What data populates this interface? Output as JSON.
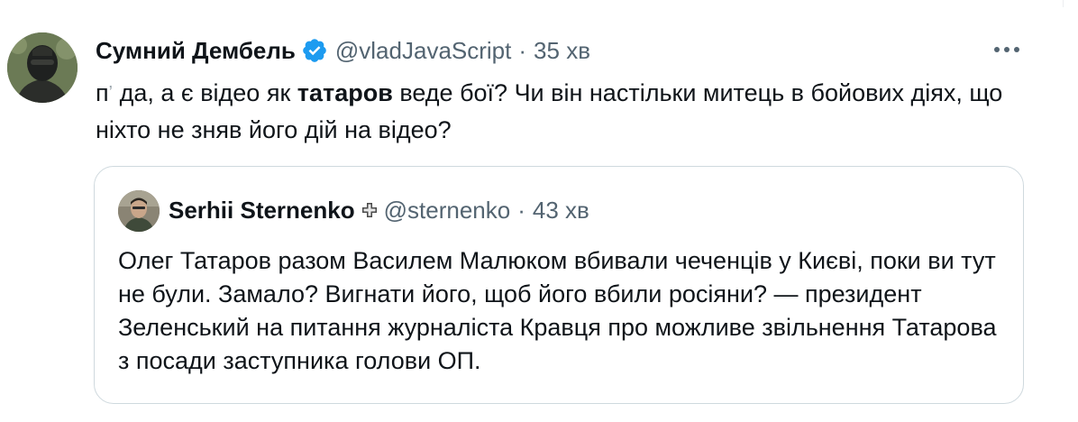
{
  "tweet": {
    "author": {
      "display_name": "Сумний Дембель",
      "handle": "@vladJavaScript",
      "time": "35 хв",
      "avatar": "avatar-masked-soldier",
      "verified": true
    },
    "separator": "·",
    "more_icon": "more-icon",
    "text": {
      "prefix": "п",
      "prefix_rest": "да, а є відео як ",
      "bold": "татаров",
      "suffix": " веде бої? Чи він настільки митець в бойових діях, що ніхто не зняв його дій на відео?"
    }
  },
  "quote": {
    "author": {
      "display_name": "Serhii Sternenko",
      "handle": "@sternenko",
      "time": "43 хв",
      "avatar": "avatar-man",
      "badge": "cross-badge-icon"
    },
    "separator": "·",
    "text": "Олег Татаров разом Василем Малюком вбивали чеченців у Києві, поки ви тут не були. Замало? Вигнати його, щоб його вбили росіяни? — президент Зеленський на питання журналіста Кравця про можливе звільнення Татарова з посади заступника голови ОП."
  },
  "colors": {
    "text_primary": "#0f1419",
    "text_secondary": "#536471",
    "verified_blue": "#1d9bf0",
    "border": "#cfd9de"
  }
}
